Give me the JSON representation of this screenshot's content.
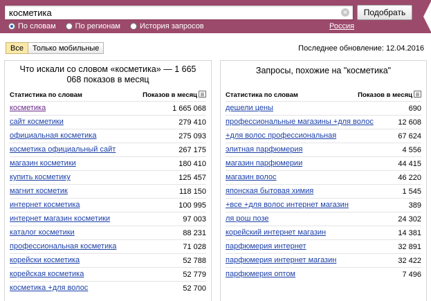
{
  "search": {
    "value": "косметика",
    "submit_label": "Подобрать",
    "modes": [
      {
        "label": "По словам",
        "selected": true
      },
      {
        "label": "По регионам",
        "selected": false
      },
      {
        "label": "История запросов",
        "selected": false
      }
    ],
    "region": "Россия"
  },
  "filters": {
    "all_label": "Все",
    "mobile_label": "Только мобильные"
  },
  "last_update": "Последнее обновление: 12.04.2016",
  "left_panel": {
    "title": "Что искали со словом «косметика» — 1 665 068 показов в месяц",
    "col_words": "Статистика по словам",
    "col_shows": "Показов в месяц",
    "rows": [
      {
        "keyword": "косметика",
        "count": "1 665 068"
      },
      {
        "keyword": "сайт косметики",
        "count": "279 410"
      },
      {
        "keyword": "официальная косметика",
        "count": "275 093"
      },
      {
        "keyword": "косметика официальный сайт",
        "count": "267 175"
      },
      {
        "keyword": "магазин косметики",
        "count": "180 410"
      },
      {
        "keyword": "купить косметику",
        "count": "125 457"
      },
      {
        "keyword": "магнит косметик",
        "count": "118 150"
      },
      {
        "keyword": "интернет косметика",
        "count": "100 995"
      },
      {
        "keyword": "интернет магазин косметики",
        "count": "97 003"
      },
      {
        "keyword": "каталог косметики",
        "count": "88 231"
      },
      {
        "keyword": "профессиональная косметика",
        "count": "71 028"
      },
      {
        "keyword": "корейски косметика",
        "count": "52 788"
      },
      {
        "keyword": "корейская косметика",
        "count": "52 779"
      },
      {
        "keyword": "косметика +для волос",
        "count": "52 700"
      }
    ]
  },
  "right_panel": {
    "title": "Запросы, похожие на \"косметика\"",
    "col_words": "Статистика по словам",
    "col_shows": "Показов в месяц",
    "rows": [
      {
        "keyword": "дешели цены",
        "count": "690"
      },
      {
        "keyword": "профессиональные магазины +для волос",
        "count": "12 608"
      },
      {
        "keyword": "+для волос профессиональная",
        "count": "67 624"
      },
      {
        "keyword": "элитная парфюмерия",
        "count": "4 556"
      },
      {
        "keyword": "магазин парфюмерии",
        "count": "44 415"
      },
      {
        "keyword": "магазин волос",
        "count": "46 220"
      },
      {
        "keyword": "японская бытовая химия",
        "count": "1 545"
      },
      {
        "keyword": "+все +для волос интернет магазин",
        "count": "389"
      },
      {
        "keyword": "ля рош позе",
        "count": "24 302"
      },
      {
        "keyword": "корейский интернет магазин",
        "count": "14 381"
      },
      {
        "keyword": "парфюмерия интернет",
        "count": "32 891"
      },
      {
        "keyword": "парфюмерия интернет магазин",
        "count": "32 422"
      },
      {
        "keyword": "парфюмерия оптом",
        "count": "7 496"
      }
    ]
  }
}
